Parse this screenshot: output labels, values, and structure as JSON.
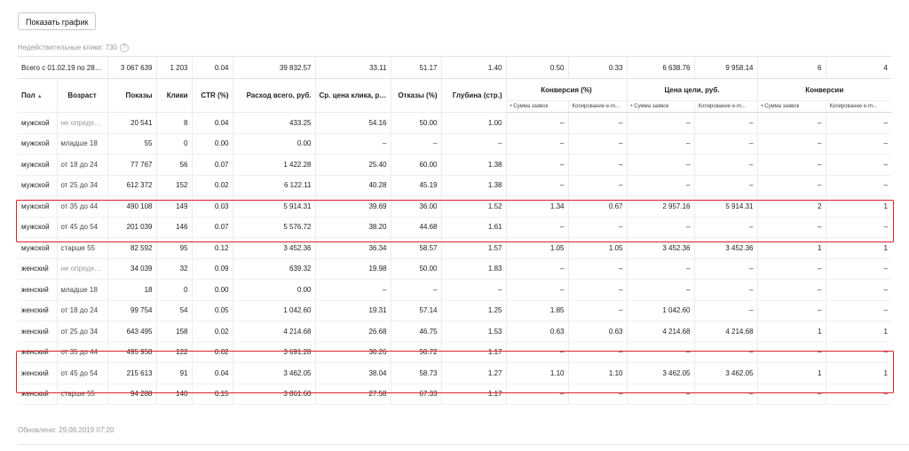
{
  "toolbar": {
    "show_chart_label": "Показать график"
  },
  "invalid_clicks": "Недействительные клики: 730",
  "total": [
    "Всего с 01.02.19 по 28.08.19",
    "3 067 639",
    "1 203",
    "0.04",
    "39 832.57",
    "33.11",
    "51.17",
    "1.40",
    "0.50",
    "0.33",
    "6 638.76",
    "9 958.14",
    "6",
    "4"
  ],
  "headers": {
    "gender": "Пол",
    "age": "Возраст",
    "impressions": "Показы",
    "clicks": "Клики",
    "ctr": "CTR (%)",
    "spend": "Расход всего, руб.",
    "avg_cpc": "Ср. цена клика, руб.",
    "bounce": "Отказы (%)",
    "depth": "Глубина (стр.)",
    "conversion": "Конверсия (%)",
    "goal_price": "Цена цели, руб.",
    "conversions": "Конверсии",
    "sub_sum": "• Сумма заявок",
    "sub_copy": "Копирование e-m..."
  },
  "rows": [
    [
      "мужской",
      "не определен",
      "20 541",
      "8",
      "0.04",
      "433.25",
      "54.16",
      "50.00",
      "1.00",
      "–",
      "–",
      "–",
      "–",
      "–",
      "–"
    ],
    [
      "мужской",
      "младше 18",
      "55",
      "0",
      "0.00",
      "0.00",
      "–",
      "–",
      "–",
      "–",
      "–",
      "–",
      "–",
      "–",
      "–"
    ],
    [
      "мужской",
      "от 18 до 24",
      "77 767",
      "56",
      "0.07",
      "1 422.28",
      "25.40",
      "60.00",
      "1.38",
      "–",
      "–",
      "–",
      "–",
      "–",
      "–"
    ],
    [
      "мужской",
      "от 25 до 34",
      "612 372",
      "152",
      "0.02",
      "6 122.11",
      "40.28",
      "45.19",
      "1.38",
      "–",
      "–",
      "–",
      "–",
      "–",
      "–"
    ],
    [
      "мужской",
      "от 35 до 44",
      "490 108",
      "149",
      "0.03",
      "5 914.31",
      "39.69",
      "36.00",
      "1.52",
      "1.34",
      "0.67",
      "2 957.16",
      "5 914.31",
      "2",
      "1"
    ],
    [
      "мужской",
      "от 45 до 54",
      "201 039",
      "146",
      "0.07",
      "5 576.72",
      "38.20",
      "44.68",
      "1.61",
      "–",
      "–",
      "–",
      "–",
      "–",
      "–"
    ],
    [
      "мужской",
      "старше 55",
      "82 592",
      "95",
      "0.12",
      "3 452.36",
      "36.34",
      "58.57",
      "1.57",
      "1.05",
      "1.05",
      "3 452.36",
      "3 452.36",
      "1",
      "1"
    ],
    [
      "женский",
      "не определен",
      "34 039",
      "32",
      "0.09",
      "639.32",
      "19.98",
      "50.00",
      "1.83",
      "–",
      "–",
      "–",
      "–",
      "–",
      "–"
    ],
    [
      "женский",
      "младше 18",
      "18",
      "0",
      "0.00",
      "0.00",
      "–",
      "–",
      "–",
      "–",
      "–",
      "–",
      "–",
      "–",
      "–"
    ],
    [
      "женский",
      "от 18 до 24",
      "99 754",
      "54",
      "0.05",
      "1 042.60",
      "19.31",
      "57.14",
      "1.25",
      "1.85",
      "–",
      "1 042.60",
      "–",
      "–",
      "–"
    ],
    [
      "женский",
      "от 25 до 34",
      "643 495",
      "158",
      "0.02",
      "4 214.68",
      "26.68",
      "46.75",
      "1.53",
      "0.63",
      "0.63",
      "4 214.68",
      "4 214.68",
      "1",
      "1"
    ],
    [
      "женский",
      "от 35 до 44",
      "495 958",
      "122",
      "0.02",
      "3 691.28",
      "30.26",
      "50.72",
      "1.17",
      "–",
      "–",
      "–",
      "–",
      "–",
      "–"
    ],
    [
      "женский",
      "от 45 до 54",
      "215 613",
      "91",
      "0.04",
      "3 462.05",
      "38.04",
      "58.73",
      "1.27",
      "1.10",
      "1.10",
      "3 462.05",
      "3 462.05",
      "1",
      "1"
    ],
    [
      "женский",
      "старше 55",
      "94 288",
      "140",
      "0.15",
      "3 861.60",
      "27.58",
      "67.33",
      "1.17",
      "–",
      "–",
      "–",
      "–",
      "–",
      "–"
    ]
  ],
  "updated": "Обновлено: 29.08.2019 07:20",
  "colors": {
    "highlight": "#e0202a",
    "border": "#ececec"
  }
}
